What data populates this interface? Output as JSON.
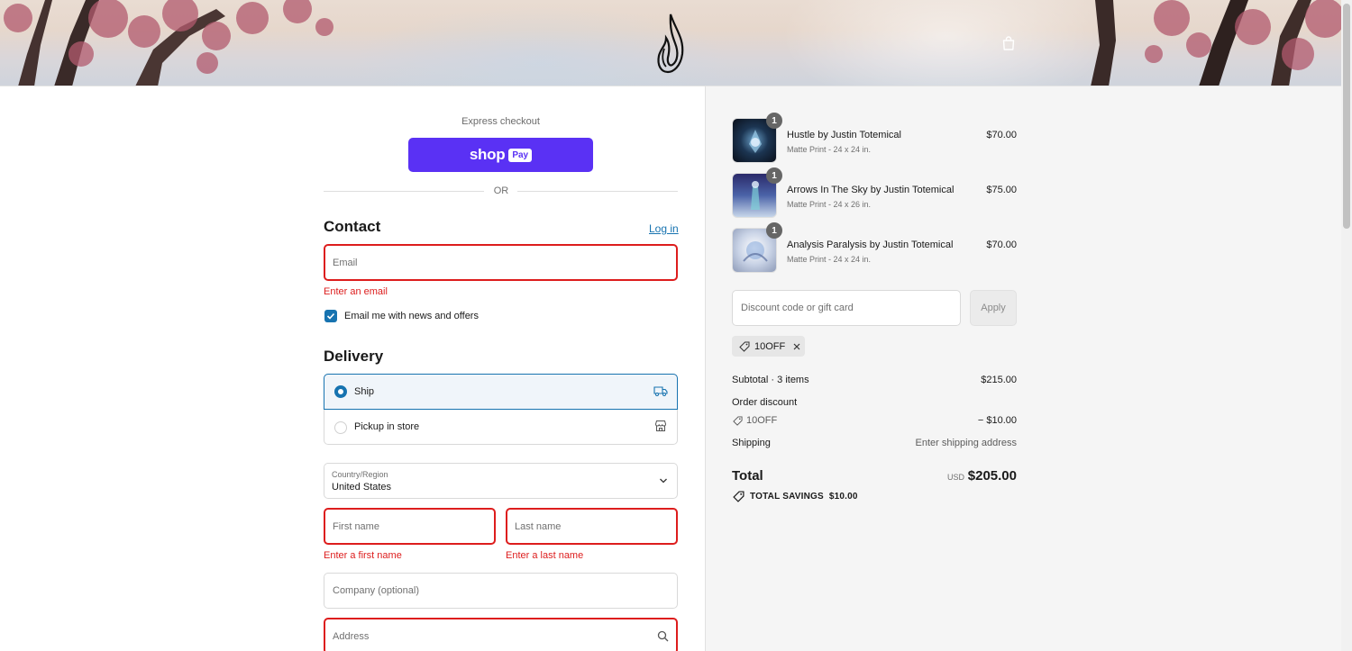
{
  "header": {
    "logo": "flame-logo",
    "cart_icon": "shopping-bag-icon"
  },
  "express": {
    "label": "Express checkout",
    "shop_text": "shop",
    "pay_text": "Pay",
    "or_text": "OR"
  },
  "contact": {
    "title": "Contact",
    "login_link": "Log in",
    "email_placeholder": "Email",
    "email_error": "Enter an email",
    "newsletter_label": "Email me with news and offers",
    "newsletter_checked": true
  },
  "delivery": {
    "title": "Delivery",
    "options": [
      {
        "label": "Ship",
        "selected": true,
        "icon": "truck-icon"
      },
      {
        "label": "Pickup in store",
        "selected": false,
        "icon": "store-icon"
      }
    ],
    "country_label": "Country/Region",
    "country_value": "United States",
    "first_name_placeholder": "First name",
    "first_name_error": "Enter a first name",
    "last_name_placeholder": "Last name",
    "last_name_error": "Enter a last name",
    "company_placeholder": "Company (optional)",
    "address_placeholder": "Address"
  },
  "cart": {
    "items": [
      {
        "name": "Hustle by Justin Totemical",
        "variant": "Matte Print - 24 x 24 in.",
        "price": "$70.00",
        "qty": "1"
      },
      {
        "name": "Arrows In The Sky by Justin Totemical",
        "variant": "Matte Print - 24 x 26 in.",
        "price": "$75.00",
        "qty": "1"
      },
      {
        "name": "Analysis Paralysis by Justin Totemical",
        "variant": "Matte Print - 24 x 24 in.",
        "price": "$70.00",
        "qty": "1"
      }
    ],
    "discount_placeholder": "Discount code or gift card",
    "apply_label": "Apply",
    "applied_code": "10OFF"
  },
  "summary": {
    "subtotal_label": "Subtotal · 3 items",
    "subtotal_value": "$215.00",
    "order_discount_label": "Order discount",
    "discount_code": "10OFF",
    "discount_value": "− $10.00",
    "shipping_label": "Shipping",
    "shipping_value": "Enter shipping address",
    "total_label": "Total",
    "currency": "USD",
    "total_value": "$205.00",
    "savings_label": "TOTAL SAVINGS",
    "savings_value": "$10.00"
  },
  "colors": {
    "accent": "#1773b0",
    "error": "#dd1d1d",
    "shop_pay": "#5a31f4"
  }
}
